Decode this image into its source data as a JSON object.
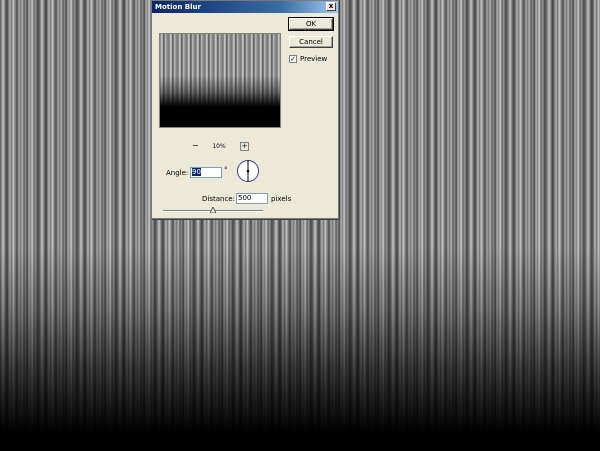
{
  "dialog": {
    "title": "Motion Blur",
    "close_glyph": "x",
    "ok_label": "OK",
    "cancel_label": "Cancel",
    "preview_label": "Preview",
    "preview_checked": true,
    "preview_check_glyph": "✓",
    "zoom": {
      "out_glyph": "−",
      "level": "10%",
      "in_glyph": "+"
    },
    "angle": {
      "label": "Angle:",
      "value": "90",
      "unit": "°"
    },
    "distance": {
      "label": "Distance:",
      "value": "500",
      "unit": "pixels",
      "slider_fraction": 0.5
    }
  },
  "colors": {
    "titlebar_start": "#0a246a",
    "dialog_bg": "#ece9d8"
  }
}
